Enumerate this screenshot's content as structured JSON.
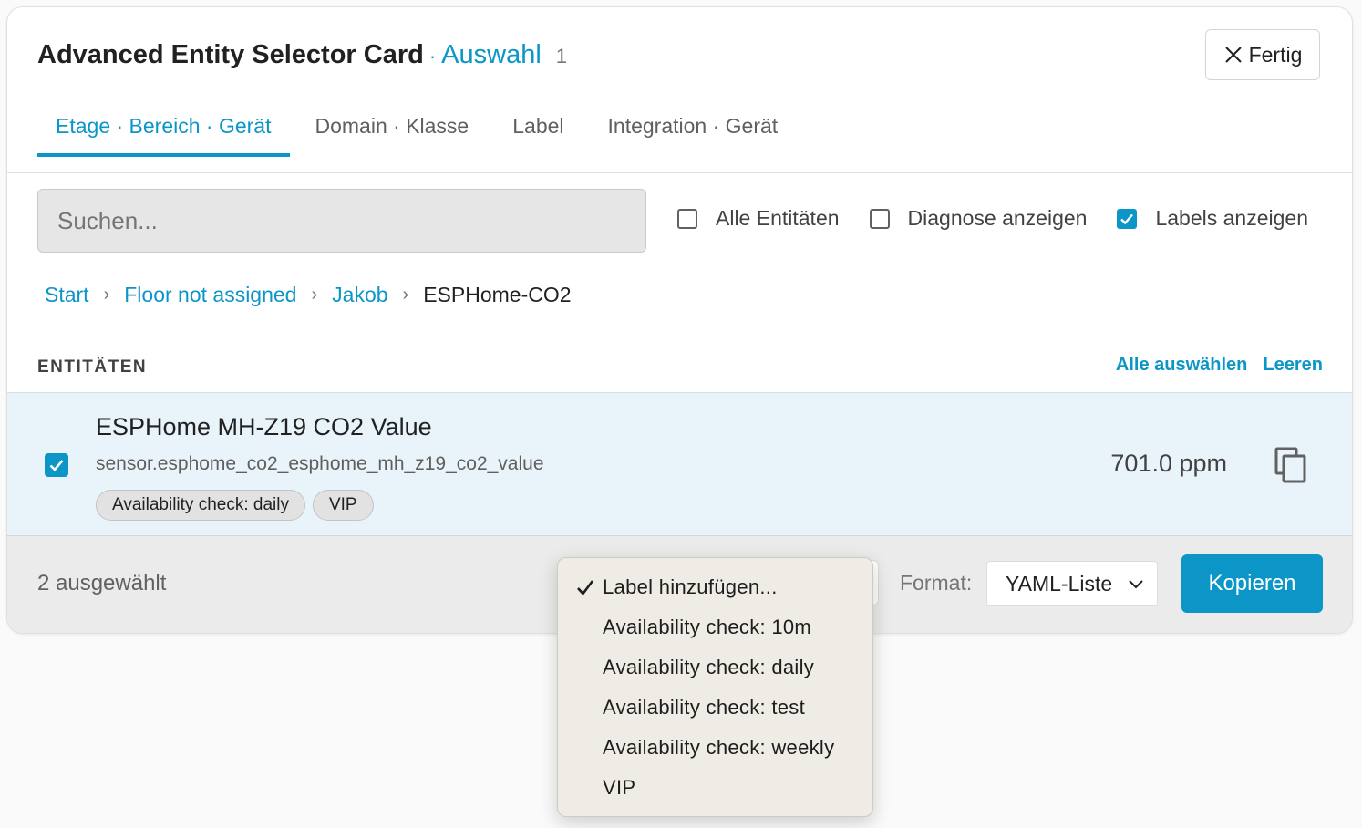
{
  "card": {
    "title": "Advanced Entity Selector Card",
    "title_separator": "·",
    "selection_label": "Auswahl",
    "selection_count": "1",
    "done_label": "Fertig"
  },
  "tabs": [
    {
      "label": "Etage · Bereich · Gerät",
      "active": true
    },
    {
      "label": "Domain · Klasse",
      "active": false
    },
    {
      "label": "Label",
      "active": false
    },
    {
      "label": "Integration · Gerät",
      "active": false
    }
  ],
  "search": {
    "placeholder": "Suchen..."
  },
  "filters": [
    {
      "label": "Alle Entitäten",
      "checked": false
    },
    {
      "label": "Diagnose anzeigen",
      "checked": false
    },
    {
      "label": "Labels anzeigen",
      "checked": true
    }
  ],
  "breadcrumb": {
    "items": [
      "Start",
      "Floor not assigned",
      "Jakob",
      "ESPHome-CO2"
    ],
    "separator": "›"
  },
  "list": {
    "heading": "ENTITÄTEN",
    "select_all": "Alle auswählen",
    "clear": "Leeren"
  },
  "entity": {
    "name": "ESPHome MH-Z19 CO2 Value",
    "entity_id": "sensor.esphome_co2_esphome_mh_z19_co2_value",
    "labels": [
      "Availability check: daily",
      "VIP"
    ],
    "value": "701.0 ppm",
    "checked": true
  },
  "footer": {
    "selected_count": "2 ausgewählt",
    "format_label": "Format:",
    "format_value": "YAML-Liste",
    "copy_label": "Kopieren"
  },
  "label_menu": {
    "selected": "Label hinzufügen...",
    "options": [
      "Label hinzufügen...",
      "Availability check: 10m",
      "Availability check: daily",
      "Availability check: test",
      "Availability check: weekly",
      "VIP"
    ]
  },
  "colors": {
    "accent": "#0b96c7",
    "row_highlight": "#e8f4fa",
    "footer_bg": "#ebebeb",
    "menu_bg": "#efece6"
  }
}
